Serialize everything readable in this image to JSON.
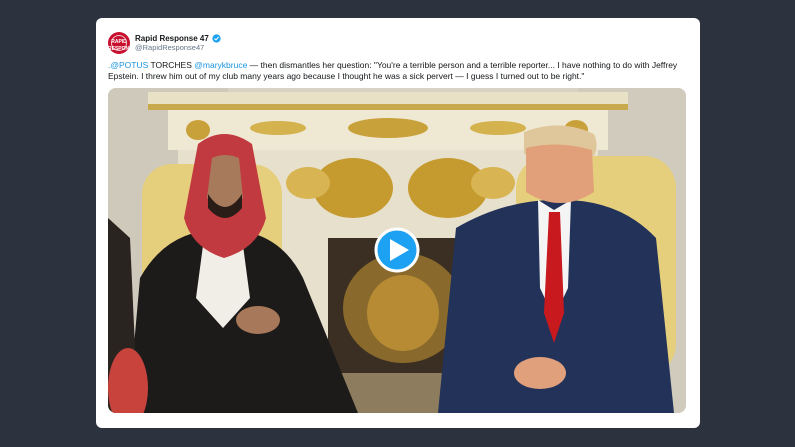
{
  "tweet": {
    "author_name": "Rapid Response 47",
    "author_handle": "@RapidResponse47",
    "avatar_text": "RAPID RESPONSE",
    "text_mention_1": ".@POTUS",
    "text_part_1": " TORCHES ",
    "text_mention_2": "@marykbruce",
    "text_part_2": " — then dismantles her question: \"You're a terrible person and a terrible reporter... I have nothing to do with Jeffrey Epstein. I threw him out of my club many years ago because I thought he was a sick pervert — I guess I turned out to be right.\""
  },
  "colors": {
    "background": "#2c333f",
    "card": "#ffffff",
    "link": "#1b95e0",
    "verified": "#1da1f2",
    "play_button": "#1da1f2",
    "avatar": "#c8102e"
  },
  "media": {
    "type": "video",
    "play_icon": "play-icon"
  }
}
